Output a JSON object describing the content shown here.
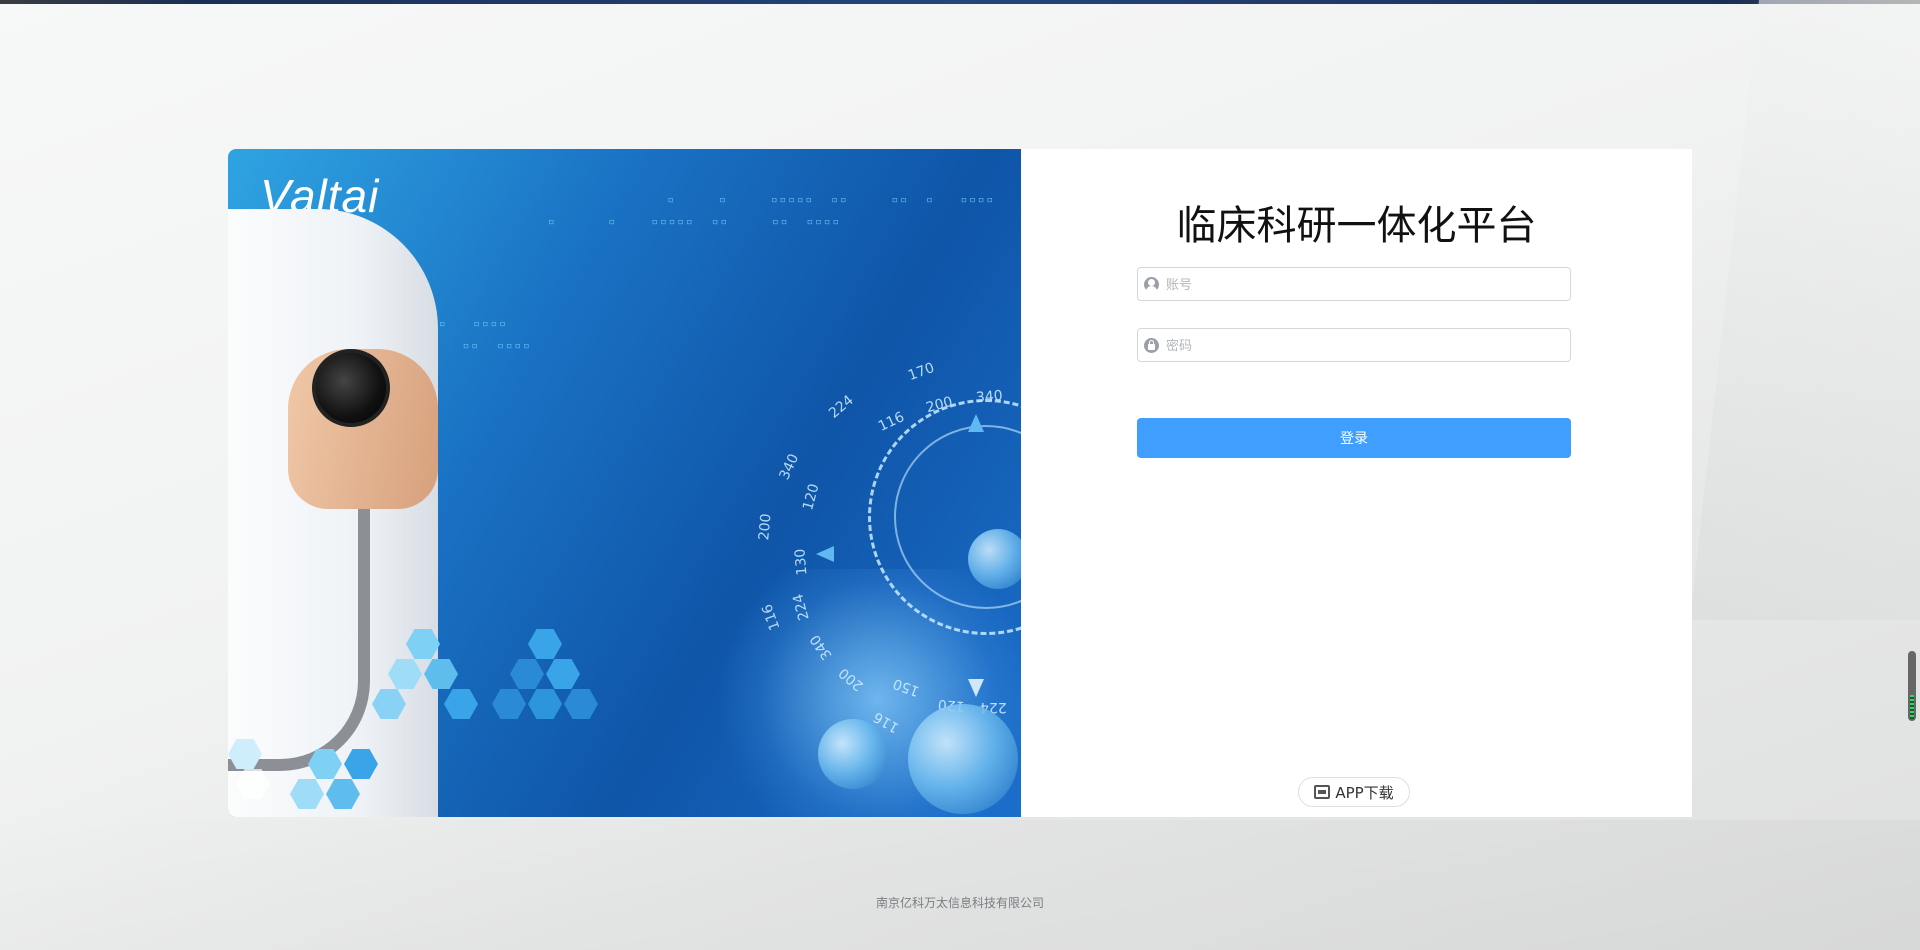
{
  "brand": {
    "logo_text": "Valtai"
  },
  "login": {
    "title": "临床科研一体化平台",
    "account_placeholder": "账号",
    "password_placeholder": "密码",
    "login_button": "登录",
    "app_download": "APP下载"
  },
  "footer": {
    "company": "南京亿科万太信息科技有限公司"
  },
  "hero": {
    "dial_numbers": [
      "170",
      "224",
      "116",
      "200",
      "340",
      "340",
      "120",
      "200",
      "130",
      "116",
      "224",
      "340",
      "200",
      "150",
      "116",
      "120",
      "224"
    ]
  },
  "colors": {
    "primary": "#409eff",
    "hero_blue": "#0f55a8"
  },
  "icons": {
    "account": "user-icon",
    "password": "lock-icon",
    "app": "mobile-app-icon"
  }
}
